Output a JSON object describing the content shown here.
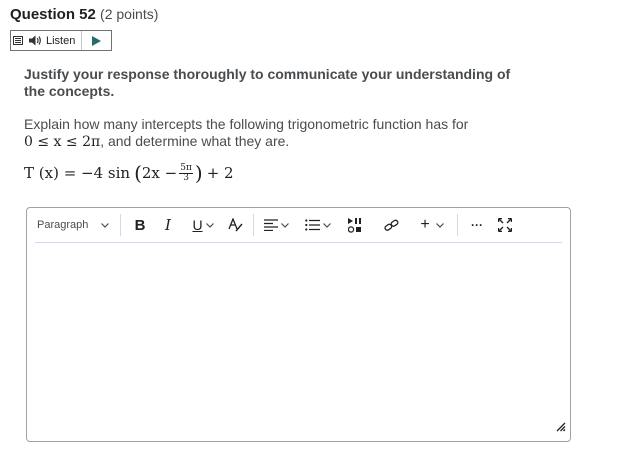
{
  "question": {
    "title": "Question 52",
    "points": "(2 points)"
  },
  "listen": {
    "label": "Listen"
  },
  "content": {
    "instruction": "Justify your response thoroughly to communicate your understanding of the concepts.",
    "prompt_text": "Explain how many intercepts the following trigonometric function has for",
    "prompt_range": "0 ≤ x ≤ 2π",
    "prompt_suffix": ", and determine what they are.",
    "formula": {
      "lhs": "T (x) = −4 sin",
      "inner_left": "2x −",
      "frac_num": "5π",
      "frac_den": "3",
      "tail": "+ 2"
    }
  },
  "editor": {
    "format_select": "Paragraph",
    "bold_label": "B",
    "italic_label": "I",
    "underline_label": "U",
    "insert_label": "+",
    "more_label": "···"
  },
  "colors": {
    "text": "#202122",
    "muted": "#494c4e",
    "border": "#9ea2a4"
  }
}
